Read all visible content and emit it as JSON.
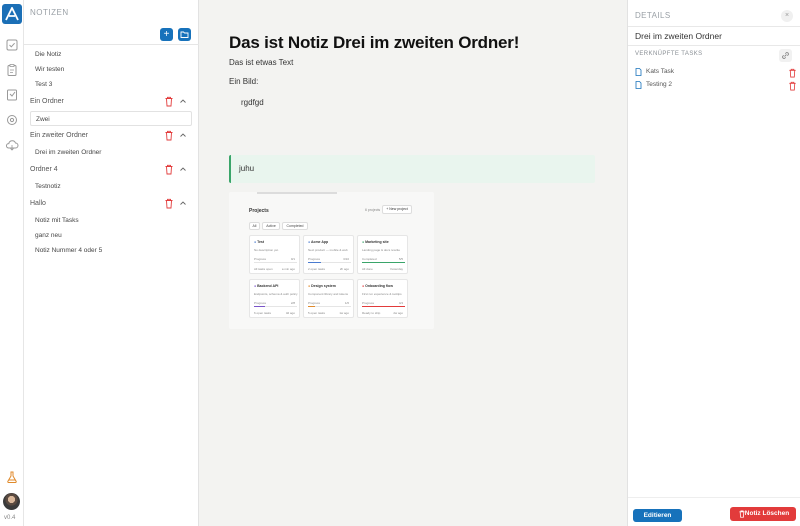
{
  "app": {
    "version": "v0.4"
  },
  "sidebar": {
    "title": "NOTIZEN",
    "add_label": "+",
    "loose_notes": [
      "Die Notiz",
      "Wir testen",
      "Test 3"
    ],
    "folders": [
      {
        "name": "Ein Ordner",
        "notes": [
          "Zwei"
        ]
      },
      {
        "name": "Ein zweiter Ordner",
        "notes": [
          "Drei im zweiten Ordner"
        ]
      },
      {
        "name": "Ordner 4",
        "notes": [
          "Testnotiz"
        ]
      },
      {
        "name": "Hallo",
        "notes": [
          "Notiz mit Tasks",
          "ganz neu",
          "Notiz Nummer 4 oder 5"
        ]
      }
    ]
  },
  "note": {
    "title": "Das ist Notiz Drei im zweiten Ordner!",
    "text": "Das ist etwas Text",
    "image_label": "Ein Bild:",
    "indented": "rgdfgd",
    "callout": "juhu",
    "embedded_screenshot": {
      "title": "Projects",
      "count": "6 projects",
      "new_button": "+ New project",
      "filters": [
        "All",
        "Active",
        "Completed"
      ],
      "cards": [
        {
          "name": "Test",
          "desc": "No description yet.",
          "progress_label": "Progress",
          "progress_value": "0/1",
          "footer": "All tasks open",
          "age": "a min ago",
          "color": "#4a7bd0",
          "progress": 0
        },
        {
          "name": "Acme App",
          "desc": "Next product — mobile & web",
          "progress_label": "Progress",
          "progress_value": "3/10",
          "footer": "2 open tasks",
          "age": "2h ago",
          "color": "#4a7bd0",
          "progress": 0.3
        },
        {
          "name": "Marketing site",
          "desc": "Landing page & docs rewrite",
          "progress_label": "Completed",
          "progress_value": "5/5",
          "footer": "All done",
          "age": "Yesterday",
          "color": "#3aa56a",
          "progress": 1
        },
        {
          "name": "Backend API",
          "desc": "Endpoints, schema & auth policy",
          "progress_label": "Progress",
          "progress_value": "2/8",
          "footer": "6 open tasks",
          "age": "3d ago",
          "color": "#7a55c9",
          "progress": 0.25
        },
        {
          "name": "Design system",
          "desc": "Component library and tokens",
          "progress_label": "Progress",
          "progress_value": "1/6",
          "footer": "5 open tasks",
          "age": "1w ago",
          "color": "#e08a2b",
          "progress": 0.17
        },
        {
          "name": "Onboarding flow",
          "desc": "First run experience & tooltips",
          "progress_label": "Progress",
          "progress_value": "4/4",
          "footer": "Ready to ship",
          "age": "2w ago",
          "color": "#e23b3b",
          "progress": 1
        }
      ]
    }
  },
  "details": {
    "title": "DETAILS",
    "close_label": "×",
    "note_name": "Drei im zweiten Ordner",
    "tasks_header": "VERKNÜPFTE TASKS",
    "tasks": [
      "Kats Task",
      "Testing 2"
    ],
    "edit_label": "Editieren",
    "delete_label": "Notiz Löschen"
  },
  "colors": {
    "primary": "#1772bb",
    "danger": "#e23b3b",
    "callout": "#e9f5ee",
    "callout_border": "#3aa56a"
  }
}
